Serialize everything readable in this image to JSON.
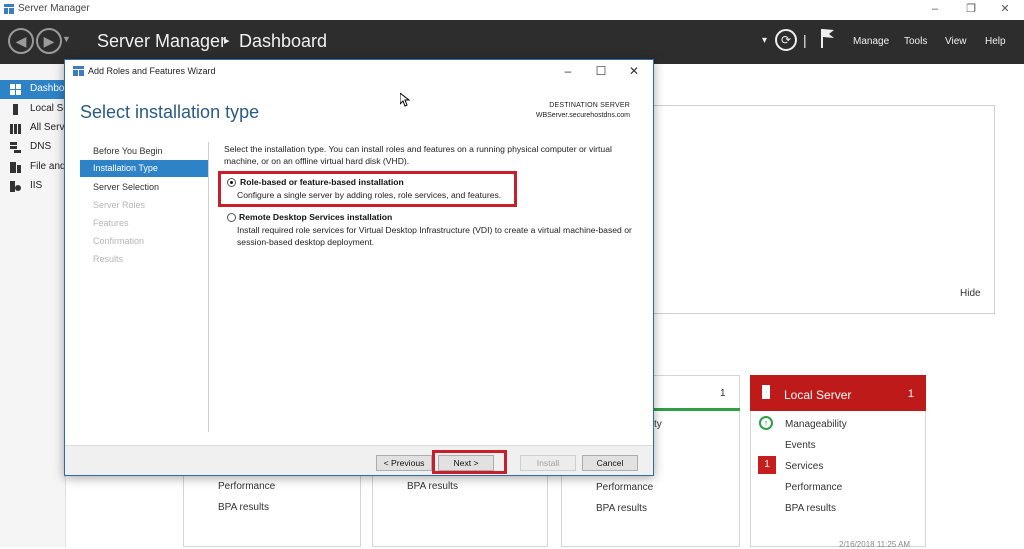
{
  "window": {
    "title": "Server Manager",
    "minimize": "–",
    "restore": "❐",
    "close": "✕"
  },
  "header": {
    "app_name": "Server Manager",
    "separator": "▸",
    "page": "Dashboard",
    "menus": [
      "Manage",
      "Tools",
      "View",
      "Help"
    ],
    "dropdown_arrow": "▾",
    "divider": "|"
  },
  "sidebar": {
    "items": [
      {
        "label": "Dashboard",
        "icon": "dashboard-icon"
      },
      {
        "label": "Local Server",
        "icon": "server-icon"
      },
      {
        "label": "All Servers",
        "icon": "servers-icon"
      },
      {
        "label": "DNS",
        "icon": "dns-icon"
      },
      {
        "label": "File and Storage Services",
        "icon": "storage-icon"
      },
      {
        "label": "IIS",
        "icon": "iis-icon"
      }
    ]
  },
  "dashboard": {
    "hide_label": "Hide",
    "tile3_count": "1",
    "tile3_partial": "ty",
    "tile_rows": [
      "Performance",
      "BPA results"
    ],
    "local_server": {
      "title": "Local Server",
      "count": "1",
      "rows": [
        "Manageability",
        "Events",
        "Services",
        "Performance",
        "BPA results"
      ],
      "services_badge": "1",
      "timestamp": "2/16/2018 11:25 AM"
    }
  },
  "wizard": {
    "title": "Add Roles and Features Wizard",
    "heading": "Select installation type",
    "destination_label": "DESTINATION SERVER",
    "destination_server": "WBServer.securehostdns.com",
    "steps": [
      {
        "label": "Before You Begin",
        "state": "normal"
      },
      {
        "label": "Installation Type",
        "state": "active"
      },
      {
        "label": "Server Selection",
        "state": "normal"
      },
      {
        "label": "Server Roles",
        "state": "disabled"
      },
      {
        "label": "Features",
        "state": "disabled"
      },
      {
        "label": "Confirmation",
        "state": "disabled"
      },
      {
        "label": "Results",
        "state": "disabled"
      }
    ],
    "intro": "Select the installation type. You can install roles and features on a running physical computer or virtual machine, or on an offline virtual hard disk (VHD).",
    "options": [
      {
        "title": "Role-based or feature-based installation",
        "description": "Configure a single server by adding roles, role services, and features.",
        "selected": true
      },
      {
        "title": "Remote Desktop Services installation",
        "description": "Install required role services for Virtual Desktop Infrastructure (VDI) to create a virtual machine-based or session-based desktop deployment.",
        "selected": false
      }
    ],
    "buttons": {
      "previous": "< Previous",
      "next": "Next >",
      "install": "Install",
      "cancel": "Cancel"
    }
  },
  "colors": {
    "header_bg": "#2d2d2d",
    "accent_blue": "#2e83c6",
    "alert_red": "#bf1a1a",
    "heading_blue": "#2a5b84",
    "highlight_red": "#c8202b"
  }
}
